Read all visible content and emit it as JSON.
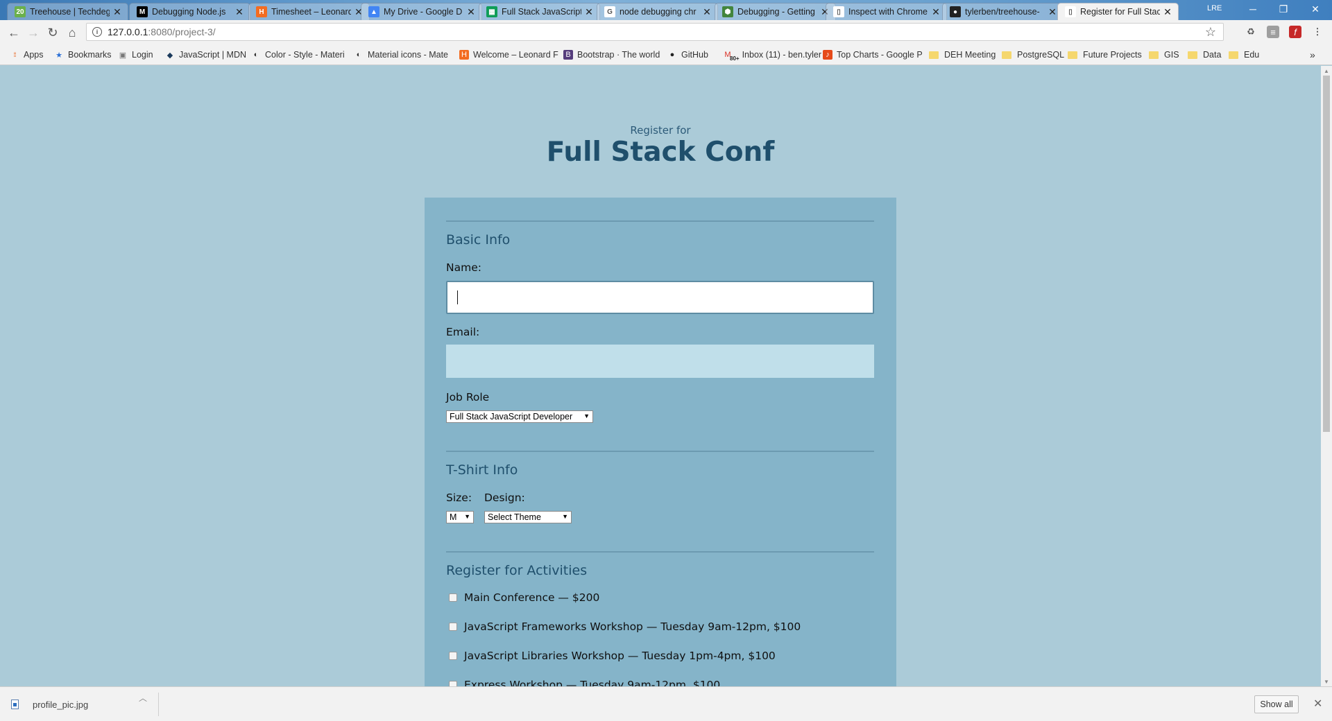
{
  "browser": {
    "tabs": [
      {
        "title": "Treehouse | Techdeg",
        "favicon": "treehouse-icon",
        "color": "#6ab04c",
        "badge": "20",
        "active": false
      },
      {
        "title": "Debugging Node.js",
        "favicon": "medium-icon",
        "color": "#000000",
        "glyph": "M",
        "active": false
      },
      {
        "title": "Timesheet – Leonard",
        "favicon": "harvest-icon",
        "color": "#f36c21",
        "glyph": "H",
        "active": false
      },
      {
        "title": "My Drive - Google D",
        "favicon": "google-drive-icon",
        "color": "#4285f4",
        "glyph": "▲",
        "active": false
      },
      {
        "title": "Full Stack JavaScript",
        "favicon": "sheets-icon",
        "color": "#0f9d58",
        "glyph": "▦",
        "active": false
      },
      {
        "title": "node debugging chr",
        "favicon": "google-icon",
        "color": "#ffffff",
        "glyph": "G",
        "active": false
      },
      {
        "title": "Debugging - Getting",
        "favicon": "node-icon",
        "color": "#43853d",
        "glyph": "⬢",
        "active": false
      },
      {
        "title": "Inspect with Chrome",
        "favicon": "page-icon",
        "color": "#ffffff",
        "glyph": "▯",
        "active": false
      },
      {
        "title": "tylerben/treehouse-",
        "favicon": "github-icon",
        "color": "#222222",
        "glyph": "●",
        "active": false
      },
      {
        "title": "Register for Full Stac",
        "favicon": "page-icon",
        "color": "#ffffff",
        "glyph": "▯",
        "active": true
      }
    ],
    "user_label": "LRE",
    "url_host": "127.0.0.1",
    "url_path": ":8080/project-3/",
    "bookmarks": [
      {
        "label": "Apps",
        "icon": "apps-grid-icon"
      },
      {
        "label": "Bookmarks",
        "icon": "star-icon"
      },
      {
        "label": "Login",
        "icon": "login-icon"
      },
      {
        "label": "JavaScript | MDN",
        "icon": "mdn-icon"
      },
      {
        "label": "Color - Style - Materi",
        "icon": "material-icon"
      },
      {
        "label": "Material icons - Mate",
        "icon": "material-icon"
      },
      {
        "label": "Welcome – Leonard F",
        "icon": "harvest-icon"
      },
      {
        "label": "Bootstrap · The world",
        "icon": "bootstrap-icon"
      },
      {
        "label": "GitHub",
        "icon": "github-icon"
      },
      {
        "label": "Inbox (11) - ben.tyler",
        "icon": "gmail-icon",
        "badge": "80+"
      },
      {
        "label": "Top Charts - Google P",
        "icon": "play-icon"
      },
      {
        "label": "DEH Meeting",
        "icon": "folder-icon"
      },
      {
        "label": "PostgreSQL",
        "icon": "folder-icon"
      },
      {
        "label": "Future Projects",
        "icon": "folder-icon"
      },
      {
        "label": "GIS",
        "icon": "folder-icon"
      },
      {
        "label": "Data",
        "icon": "folder-icon"
      },
      {
        "label": "Edu",
        "icon": "folder-icon"
      }
    ],
    "overflow_label": "»"
  },
  "page": {
    "pre_title": "Register for",
    "title": "Full Stack Conf",
    "basic_info": {
      "heading": "Basic Info",
      "name_label": "Name:",
      "name_value": "",
      "email_label": "Email:",
      "email_value": "",
      "job_role_label": "Job Role",
      "job_role_selected": "Full Stack JavaScript Developer"
    },
    "tshirt": {
      "heading": "T-Shirt Info",
      "size_label": "Size:",
      "size_selected": "M",
      "design_label": "Design:",
      "design_selected": "Select Theme"
    },
    "activities": {
      "heading": "Register for Activities",
      "items": [
        {
          "label": "Main Conference — $200",
          "checked": false
        },
        {
          "label": "JavaScript Frameworks Workshop — Tuesday 9am-12pm, $100",
          "checked": false
        },
        {
          "label": "JavaScript Libraries Workshop — Tuesday 1pm-4pm, $100",
          "checked": false
        },
        {
          "label": "Express Workshop — Tuesday 9am-12pm, $100",
          "checked": false
        }
      ]
    }
  },
  "downloads": {
    "file_name": "profile_pic.jpg",
    "show_all_label": "Show all"
  },
  "colors": {
    "page_bg": "#abcbd8",
    "form_bg": "#85b4c9",
    "heading": "#1f4f6c"
  }
}
